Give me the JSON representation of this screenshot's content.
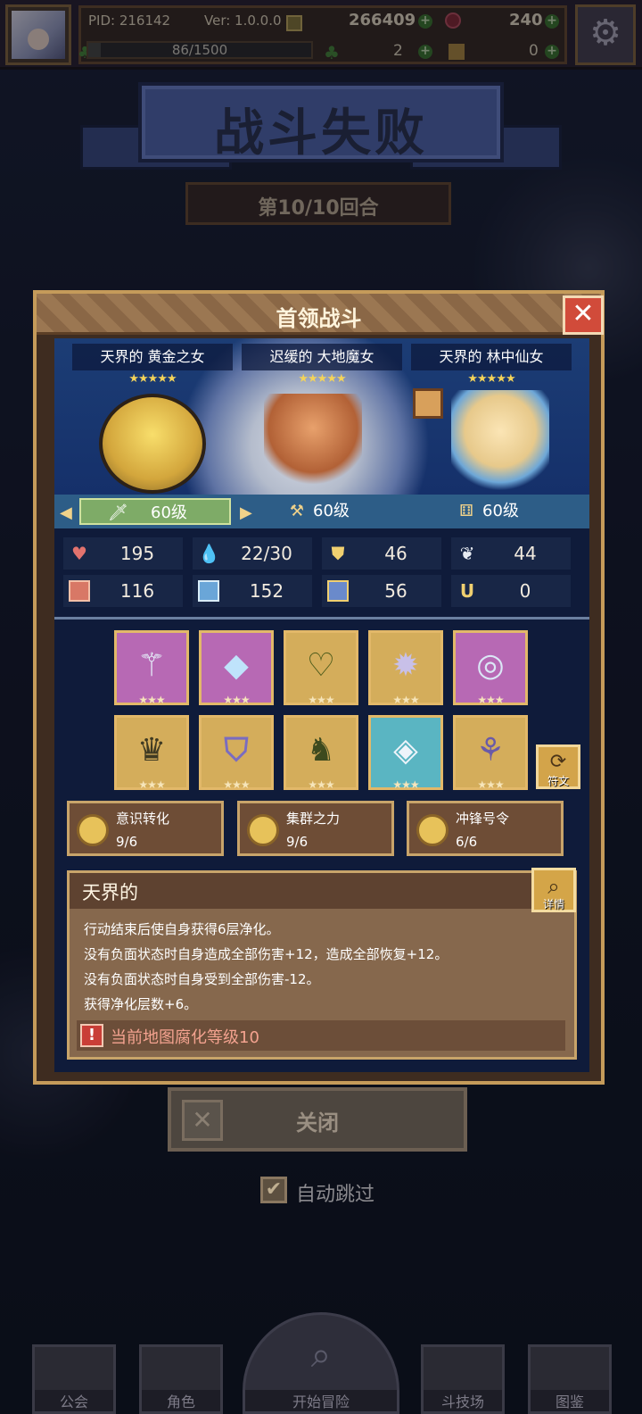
{
  "topbar": {
    "pid": "PID: 216142",
    "version": "Ver: 1.0.0.0",
    "gold": "266409",
    "gems": "240",
    "stamina": "86/1500",
    "stamina_progress": 0.057,
    "clover": "2",
    "ticket": "0",
    "plus": "+"
  },
  "banner": {
    "title": "战斗失败",
    "round": "第10/10回合"
  },
  "modal": {
    "title": "首领战斗",
    "close_glyph": "✕",
    "heroes": [
      {
        "name": "天界的 黄金之女",
        "stars": "★★★★★"
      },
      {
        "name": "迟缓的 大地魔女",
        "stars": "★★★★★"
      },
      {
        "name": "天界的 林中仙女",
        "stars": "★★★★★"
      }
    ],
    "levels": [
      "60级",
      "60级",
      "60级"
    ],
    "stats": [
      {
        "icon": "heart-icon",
        "value": "195"
      },
      {
        "icon": "mana-drop-icon",
        "value": "22/30"
      },
      {
        "icon": "shield-icon",
        "value": "46"
      },
      {
        "icon": "wing-icon",
        "value": "44"
      },
      {
        "icon": "fist-icon",
        "value": "116"
      },
      {
        "icon": "book-icon",
        "value": "152"
      },
      {
        "icon": "armor-icon",
        "value": "56"
      },
      {
        "icon": "horseshoe-icon",
        "value": "0"
      }
    ],
    "equipment": [
      {
        "icon": "staff-icon",
        "color": "pink",
        "stars": "★★★"
      },
      {
        "icon": "diamond-icon",
        "color": "pink",
        "stars": "★★★"
      },
      {
        "icon": "amulet-icon",
        "color": "gold",
        "stars": "★★★"
      },
      {
        "icon": "gear-gem-icon",
        "color": "gold",
        "stars": "★★★"
      },
      {
        "icon": "ring-icon",
        "color": "pink",
        "stars": "★★★"
      },
      {
        "icon": "helmet-icon",
        "color": "gold",
        "stars": "★★★"
      },
      {
        "icon": "chestplate-icon",
        "color": "gold",
        "stars": "★★★"
      },
      {
        "icon": "mask-icon",
        "color": "gold",
        "stars": "★★★"
      },
      {
        "icon": "crystal-ring-icon",
        "color": "teal",
        "stars": "★★★"
      },
      {
        "icon": "boots-icon",
        "color": "gold",
        "stars": "★★★"
      }
    ],
    "rune_label": "符文",
    "synergies": [
      {
        "name": "意识转化",
        "count": "9/6"
      },
      {
        "name": "集群之力",
        "count": "9/6"
      },
      {
        "name": "冲锋号令",
        "count": "6/6"
      }
    ],
    "description": {
      "title": "天界的",
      "detail_label": "详情",
      "lines": [
        "行动结束后使自身获得6层净化。",
        "没有负面状态时自身造成全部伤害+12，造成全部恢复+12。",
        "没有负面状态时自身受到全部伤害-12。",
        "获得净化层数+6。"
      ],
      "warning_icon": "!",
      "warning": "当前地图腐化等级10"
    }
  },
  "close_button": {
    "label": "关闭",
    "icon": "✕"
  },
  "auto_skip": {
    "label": "自动跳过",
    "check": "✔"
  },
  "bottom_nav": [
    {
      "label": "公会"
    },
    {
      "label": "角色"
    },
    {
      "label": "开始冒险"
    },
    {
      "label": "斗技场"
    },
    {
      "label": "图鉴"
    }
  ],
  "colors": {
    "accent_gold": "#c59b5a",
    "banner_blue": "#556ab2",
    "warning_red": "#c93e37"
  }
}
